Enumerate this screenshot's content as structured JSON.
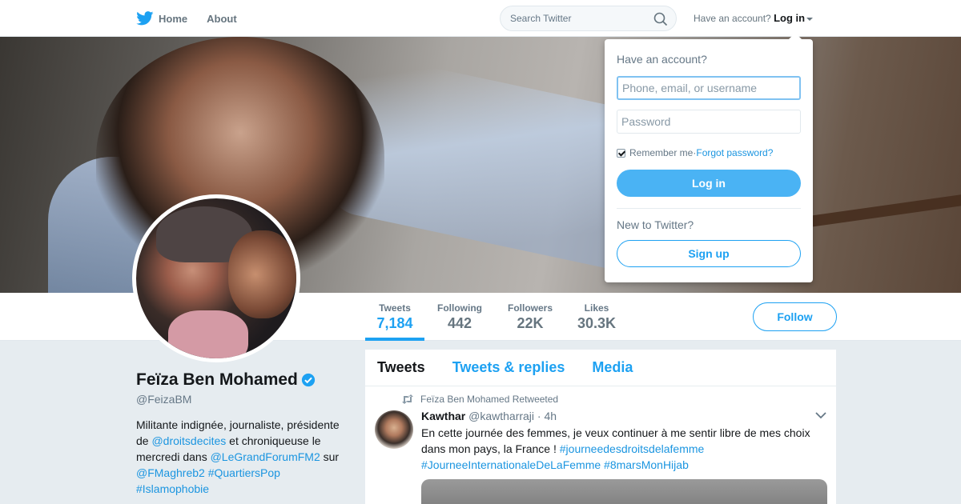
{
  "nav": {
    "home_label": "Home",
    "about_label": "About",
    "search_placeholder": "Search Twitter",
    "have_account": "Have an account?",
    "login_label": "Log in"
  },
  "profile": {
    "name": "Feïza Ben Mohamed",
    "handle": "@FeizaBM",
    "bio": {
      "t1": "Militante indignée, journaliste, présidente de ",
      "m1": "@droitsdecites",
      "t2": " et chroniqueuse le mercredi dans ",
      "m2": "@LeGrandForumFM2",
      "t3": " sur ",
      "m3": "@FMaghreb2",
      "t4": " ",
      "h1": "#QuartiersPop",
      "h2": "#Islamophobie"
    }
  },
  "stats": [
    {
      "label": "Tweets",
      "value": "7,184"
    },
    {
      "label": "Following",
      "value": "442"
    },
    {
      "label": "Followers",
      "value": "22K"
    },
    {
      "label": "Likes",
      "value": "30.3K"
    }
  ],
  "follow_label": "Follow",
  "timeline": {
    "tabs": [
      "Tweets",
      "Tweets & replies",
      "Media"
    ],
    "tweet": {
      "retweet_context": "Feïza Ben Mohamed Retweeted",
      "author_name": "Kawthar",
      "author_handle": "@kawtharraji",
      "time": "· 4h",
      "text": "En cette journée des femmes, je veux continuer à me sentir libre de mes choix dans mon pays, la France ! ",
      "tag1": "#journeedesdroitsdelafemme",
      "tag2": "#JourneeInternationaleDeLaFemme",
      "tag3": "#8marsMonHijab"
    }
  },
  "login_dropdown": {
    "title": "Have an account?",
    "username_placeholder": "Phone, email, or username",
    "password_placeholder": "Password",
    "remember_me": "Remember me",
    "separator": " · ",
    "forgot_password": "Forgot password?",
    "login_button": "Log in",
    "new_to_twitter": "New to Twitter?",
    "signup_button": "Sign up"
  },
  "colors": {
    "accent": "#1da1f2",
    "link": "#1b95e0",
    "login_button_bg": "#4ab3f4"
  }
}
